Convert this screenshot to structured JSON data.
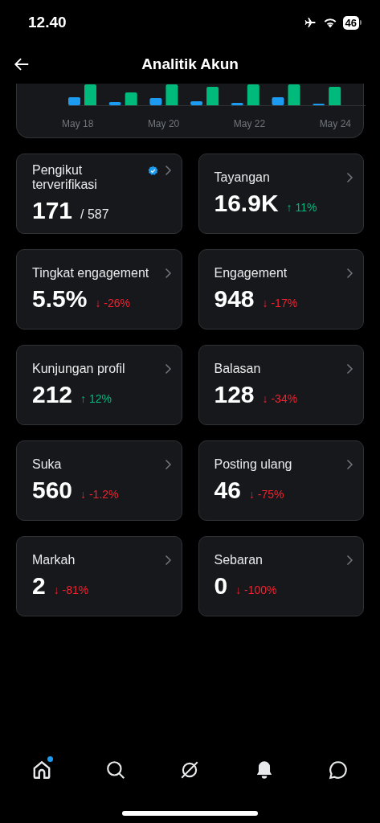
{
  "status_bar": {
    "time": "12.40",
    "battery": "46"
  },
  "header": {
    "title": "Analitik Akun"
  },
  "chart": {
    "x_labels": [
      "May 18",
      "May 20",
      "May 22",
      "May 24"
    ]
  },
  "metrics": [
    {
      "label": "Pengikut terverifikasi",
      "value": "171",
      "total": "/ 587",
      "verified": true
    },
    {
      "label": "Tayangan",
      "value": "16.9K",
      "delta": "↑ 11%",
      "color": "#00ba7c"
    },
    {
      "label": "Tingkat engagement",
      "value": "5.5%",
      "delta": "↓ -26%",
      "color": "#f4212e"
    },
    {
      "label": "Engagement",
      "value": "948",
      "delta": "↓ -17%",
      "color": "#f4212e"
    },
    {
      "label": "Kunjungan profil",
      "value": "212",
      "delta": "↑ 12%",
      "color": "#00ba7c"
    },
    {
      "label": "Balasan",
      "value": "128",
      "delta": "↓ -34%",
      "color": "#f4212e"
    },
    {
      "label": "Suka",
      "value": "560",
      "delta": "↓ -1.2%",
      "color": "#f4212e"
    },
    {
      "label": "Posting ulang",
      "value": "46",
      "delta": "↓ -75%",
      "color": "#f4212e"
    },
    {
      "label": "Markah",
      "value": "2",
      "delta": "↓ -81%",
      "color": "#f4212e"
    },
    {
      "label": "Sebaran",
      "value": "0",
      "delta": "↓ -100%",
      "color": "#f4212e"
    }
  ],
  "tab_bar": [
    {
      "kind": "home",
      "selected": true,
      "notification": true
    },
    {
      "kind": "search",
      "selected": false,
      "notification": false
    },
    {
      "kind": "grok",
      "selected": false,
      "notification": false
    },
    {
      "kind": "bell",
      "selected": false,
      "notification": false
    },
    {
      "kind": "chat",
      "selected": false,
      "notification": false
    }
  ]
}
